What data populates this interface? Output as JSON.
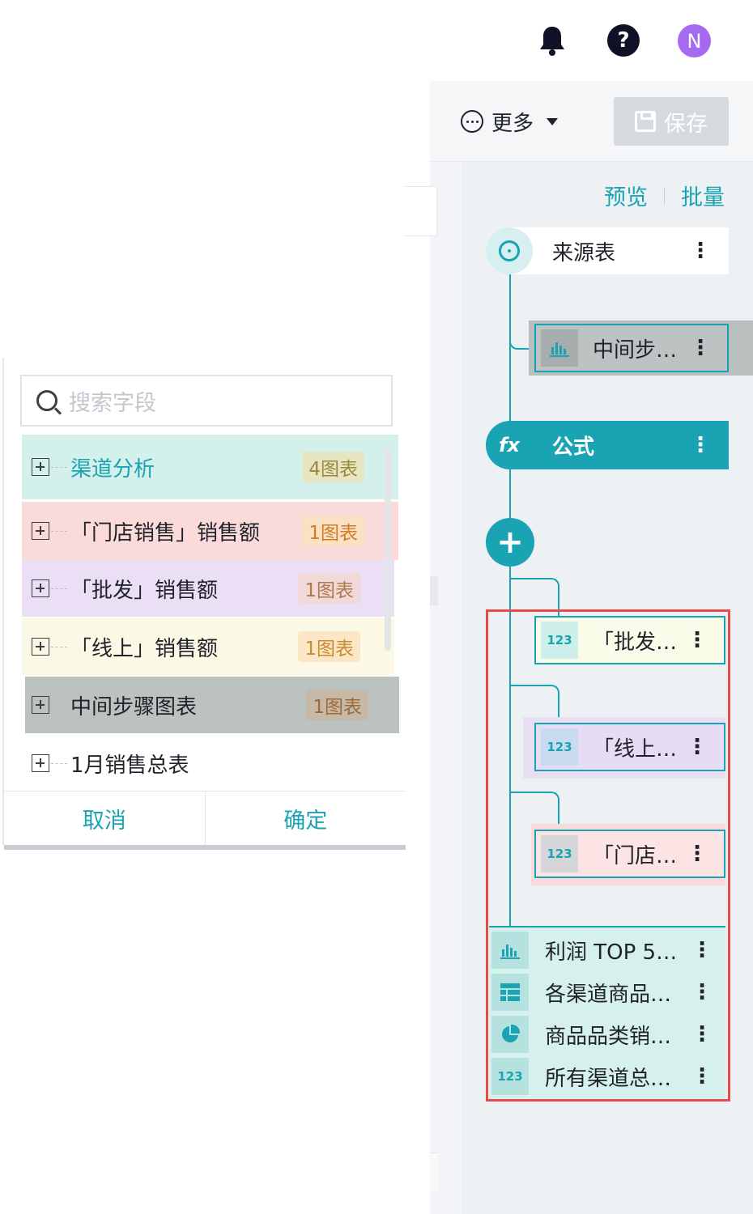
{
  "topbar": {
    "avatar_letter": "N"
  },
  "header": {
    "more_label": "更多",
    "save_label": "保存"
  },
  "flow": {
    "preview_link": "预览",
    "batch_link": "批量",
    "source_label": "来源表",
    "middle_step_label": "中间步…",
    "formula_label": "公式",
    "formula_icon": "fx",
    "add_icon": "+",
    "metric_icon_text": "123",
    "steps": [
      {
        "label": "「批发…"
      },
      {
        "label": "「线上…"
      },
      {
        "label": "「门店…"
      }
    ],
    "charts": [
      {
        "label": "利润 TOP 5…",
        "icon": "bar-chart-icon"
      },
      {
        "label": "各渠道商品…",
        "icon": "table-icon"
      },
      {
        "label": "商品品类销…",
        "icon": "pie-chart-icon"
      },
      {
        "label": "所有渠道总…",
        "icon": "number-icon",
        "icon_text": "123"
      }
    ],
    "menu_glyph": "⋮"
  },
  "dialog": {
    "search_placeholder": "搜索字段",
    "items": [
      {
        "label": "渠道分析",
        "badge": "4图表"
      },
      {
        "label": "「门店销售」销售额",
        "badge": "1图表"
      },
      {
        "label": "「批发」销售额",
        "badge": "1图表"
      },
      {
        "label": "「线上」销售额",
        "badge": "1图表"
      },
      {
        "label": "中间步骤图表",
        "badge": "1图表"
      },
      {
        "label": "1月销售总表",
        "badge": ""
      }
    ],
    "cancel_label": "取消",
    "confirm_label": "确定"
  },
  "colors": {
    "accent": "#1aa3b3",
    "highlight_border": "#e84a4a",
    "avatar": "#a66af0"
  }
}
